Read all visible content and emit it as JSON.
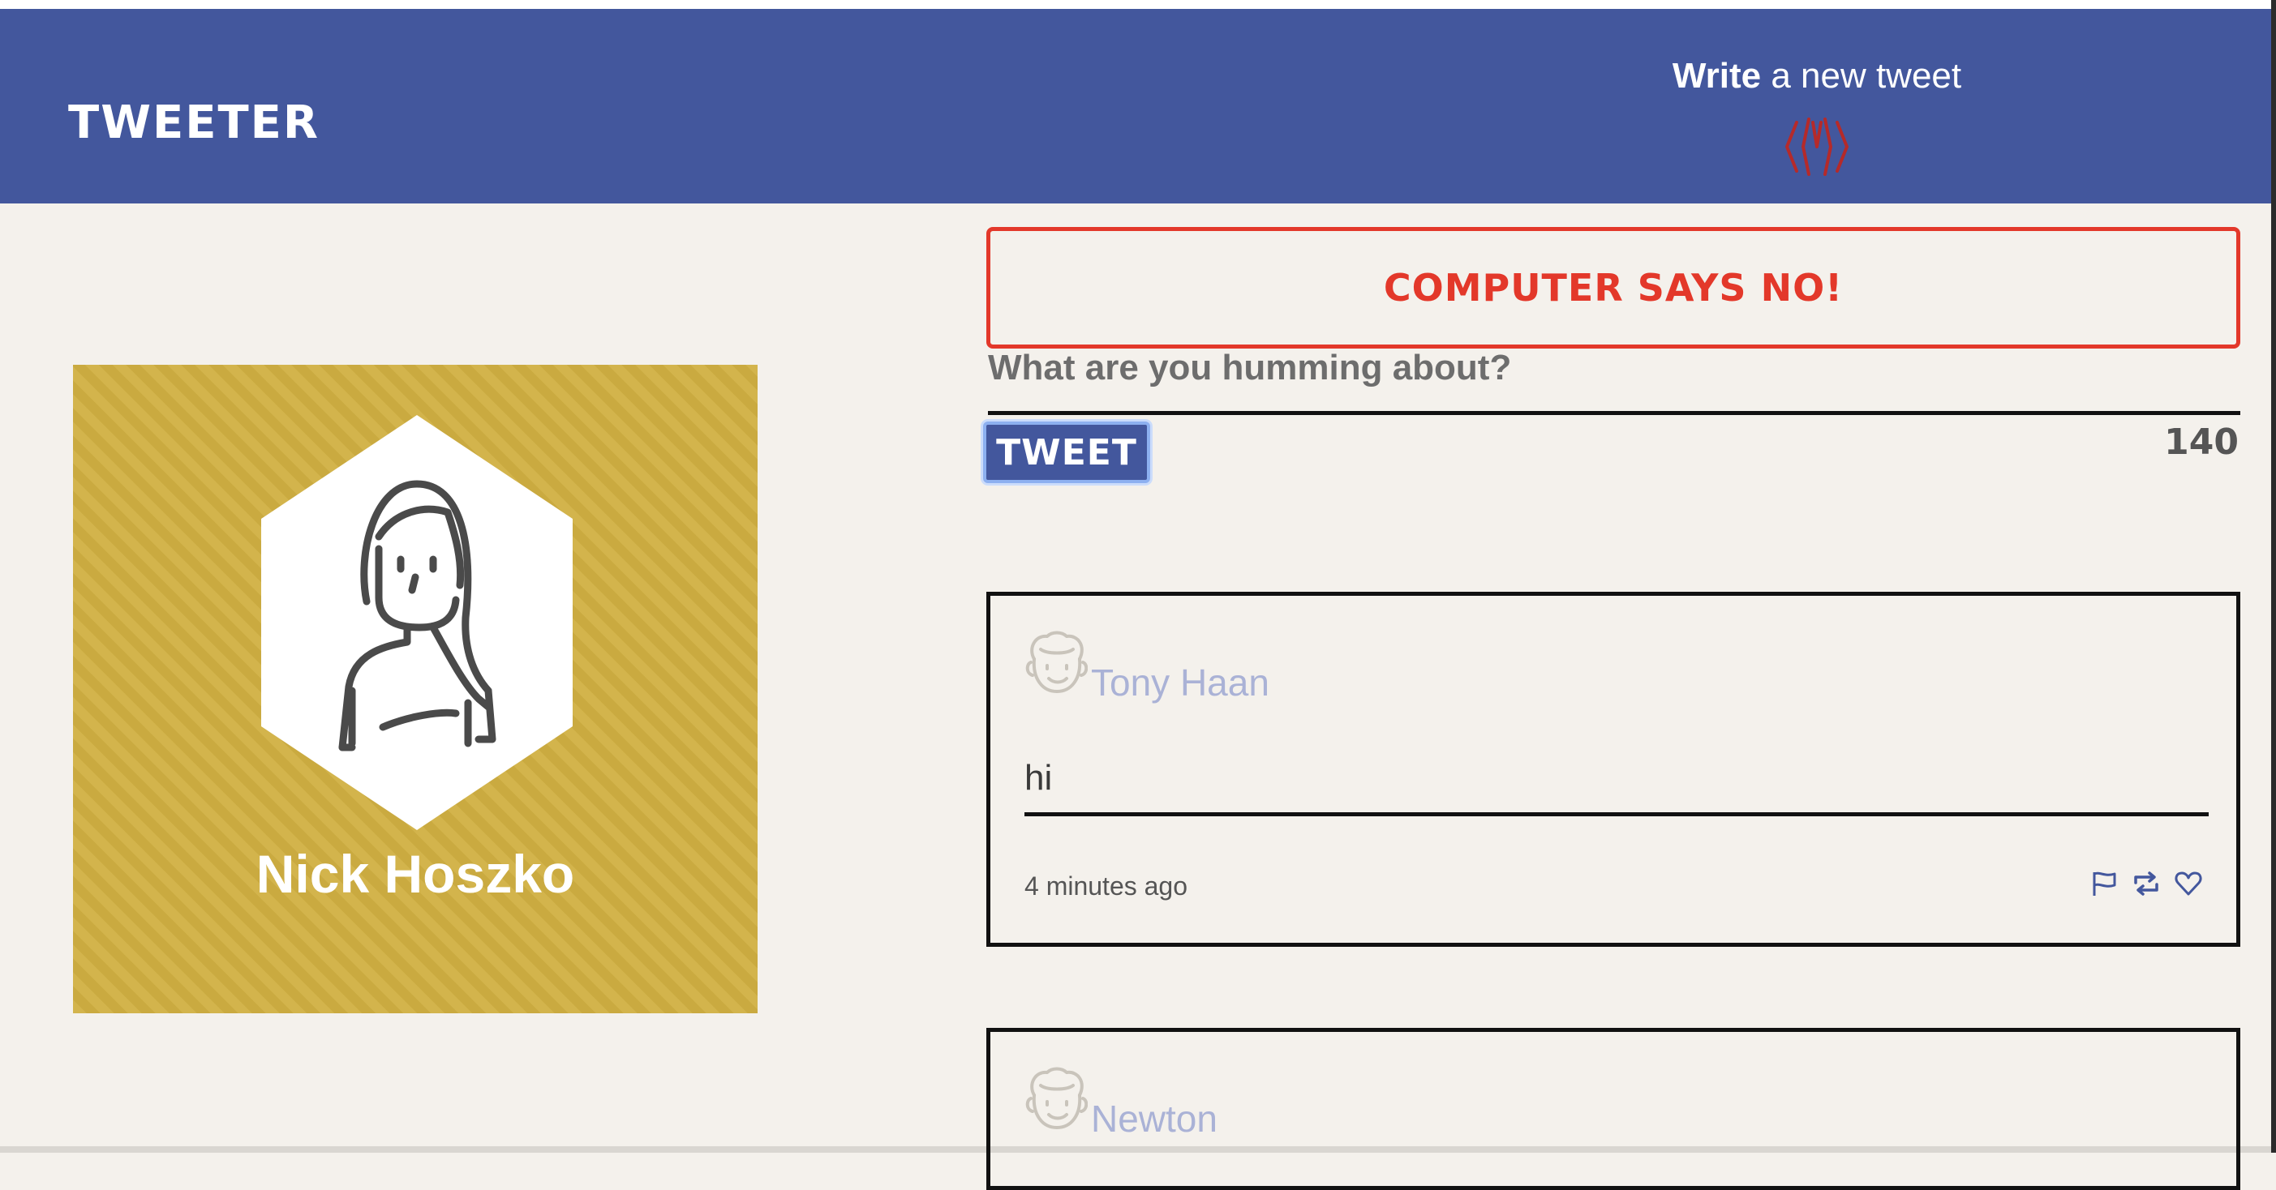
{
  "header": {
    "brand": "TWEETER",
    "compose_bold": "Write",
    "compose_rest": " a new tweet"
  },
  "profile": {
    "name": "Nick Hoszko"
  },
  "composer": {
    "error": "COMPUTER SAYS NO!",
    "placeholder": "What are you humming about?",
    "button_label": "TWEET",
    "counter": "140"
  },
  "tweets": [
    {
      "author": "Tony Haan",
      "text": "hi",
      "time": "4 minutes ago"
    },
    {
      "author": "Newton"
    }
  ],
  "colors": {
    "header": "#43579d",
    "background": "#f4f1ec",
    "profile_card": "#d1b042",
    "error": "#e3382a",
    "author": "#aab2d6"
  },
  "icons": {
    "compose_toggle": "double-chevron-down-icon",
    "tweet_actions": [
      "flag-icon",
      "retweet-icon",
      "heart-icon"
    ]
  }
}
